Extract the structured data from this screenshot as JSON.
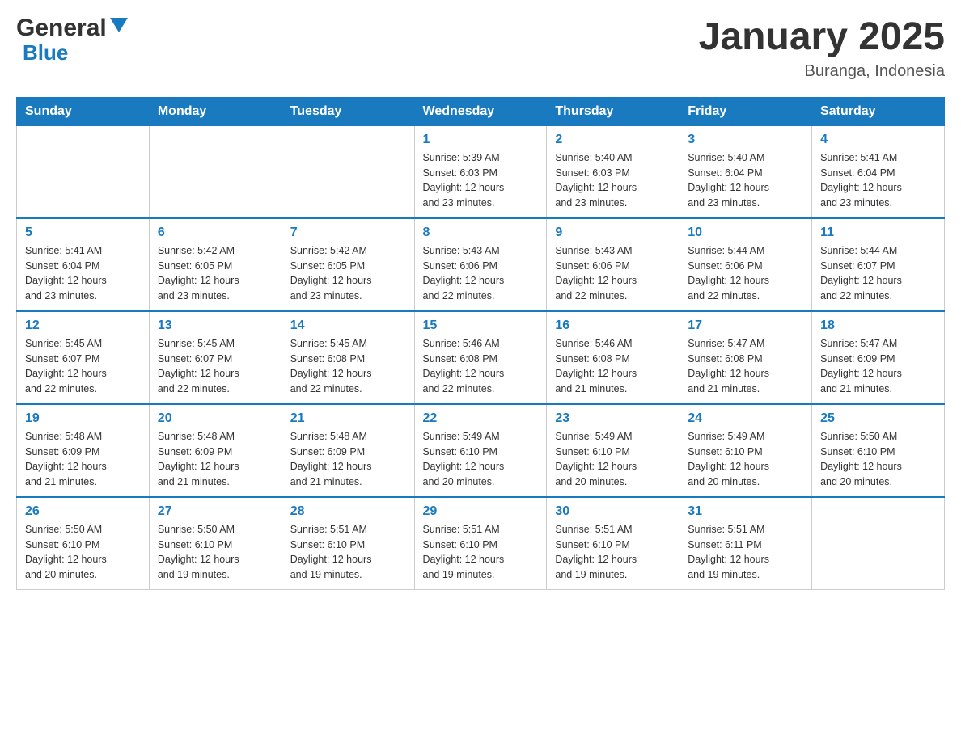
{
  "header": {
    "title": "January 2025",
    "location": "Buranga, Indonesia",
    "logo_general": "General",
    "logo_blue": "Blue"
  },
  "calendar": {
    "days_of_week": [
      "Sunday",
      "Monday",
      "Tuesday",
      "Wednesday",
      "Thursday",
      "Friday",
      "Saturday"
    ],
    "weeks": [
      [
        {
          "day": "",
          "info": ""
        },
        {
          "day": "",
          "info": ""
        },
        {
          "day": "",
          "info": ""
        },
        {
          "day": "1",
          "info": "Sunrise: 5:39 AM\nSunset: 6:03 PM\nDaylight: 12 hours\nand 23 minutes."
        },
        {
          "day": "2",
          "info": "Sunrise: 5:40 AM\nSunset: 6:03 PM\nDaylight: 12 hours\nand 23 minutes."
        },
        {
          "day": "3",
          "info": "Sunrise: 5:40 AM\nSunset: 6:04 PM\nDaylight: 12 hours\nand 23 minutes."
        },
        {
          "day": "4",
          "info": "Sunrise: 5:41 AM\nSunset: 6:04 PM\nDaylight: 12 hours\nand 23 minutes."
        }
      ],
      [
        {
          "day": "5",
          "info": "Sunrise: 5:41 AM\nSunset: 6:04 PM\nDaylight: 12 hours\nand 23 minutes."
        },
        {
          "day": "6",
          "info": "Sunrise: 5:42 AM\nSunset: 6:05 PM\nDaylight: 12 hours\nand 23 minutes."
        },
        {
          "day": "7",
          "info": "Sunrise: 5:42 AM\nSunset: 6:05 PM\nDaylight: 12 hours\nand 23 minutes."
        },
        {
          "day": "8",
          "info": "Sunrise: 5:43 AM\nSunset: 6:06 PM\nDaylight: 12 hours\nand 22 minutes."
        },
        {
          "day": "9",
          "info": "Sunrise: 5:43 AM\nSunset: 6:06 PM\nDaylight: 12 hours\nand 22 minutes."
        },
        {
          "day": "10",
          "info": "Sunrise: 5:44 AM\nSunset: 6:06 PM\nDaylight: 12 hours\nand 22 minutes."
        },
        {
          "day": "11",
          "info": "Sunrise: 5:44 AM\nSunset: 6:07 PM\nDaylight: 12 hours\nand 22 minutes."
        }
      ],
      [
        {
          "day": "12",
          "info": "Sunrise: 5:45 AM\nSunset: 6:07 PM\nDaylight: 12 hours\nand 22 minutes."
        },
        {
          "day": "13",
          "info": "Sunrise: 5:45 AM\nSunset: 6:07 PM\nDaylight: 12 hours\nand 22 minutes."
        },
        {
          "day": "14",
          "info": "Sunrise: 5:45 AM\nSunset: 6:08 PM\nDaylight: 12 hours\nand 22 minutes."
        },
        {
          "day": "15",
          "info": "Sunrise: 5:46 AM\nSunset: 6:08 PM\nDaylight: 12 hours\nand 22 minutes."
        },
        {
          "day": "16",
          "info": "Sunrise: 5:46 AM\nSunset: 6:08 PM\nDaylight: 12 hours\nand 21 minutes."
        },
        {
          "day": "17",
          "info": "Sunrise: 5:47 AM\nSunset: 6:08 PM\nDaylight: 12 hours\nand 21 minutes."
        },
        {
          "day": "18",
          "info": "Sunrise: 5:47 AM\nSunset: 6:09 PM\nDaylight: 12 hours\nand 21 minutes."
        }
      ],
      [
        {
          "day": "19",
          "info": "Sunrise: 5:48 AM\nSunset: 6:09 PM\nDaylight: 12 hours\nand 21 minutes."
        },
        {
          "day": "20",
          "info": "Sunrise: 5:48 AM\nSunset: 6:09 PM\nDaylight: 12 hours\nand 21 minutes."
        },
        {
          "day": "21",
          "info": "Sunrise: 5:48 AM\nSunset: 6:09 PM\nDaylight: 12 hours\nand 21 minutes."
        },
        {
          "day": "22",
          "info": "Sunrise: 5:49 AM\nSunset: 6:10 PM\nDaylight: 12 hours\nand 20 minutes."
        },
        {
          "day": "23",
          "info": "Sunrise: 5:49 AM\nSunset: 6:10 PM\nDaylight: 12 hours\nand 20 minutes."
        },
        {
          "day": "24",
          "info": "Sunrise: 5:49 AM\nSunset: 6:10 PM\nDaylight: 12 hours\nand 20 minutes."
        },
        {
          "day": "25",
          "info": "Sunrise: 5:50 AM\nSunset: 6:10 PM\nDaylight: 12 hours\nand 20 minutes."
        }
      ],
      [
        {
          "day": "26",
          "info": "Sunrise: 5:50 AM\nSunset: 6:10 PM\nDaylight: 12 hours\nand 20 minutes."
        },
        {
          "day": "27",
          "info": "Sunrise: 5:50 AM\nSunset: 6:10 PM\nDaylight: 12 hours\nand 19 minutes."
        },
        {
          "day": "28",
          "info": "Sunrise: 5:51 AM\nSunset: 6:10 PM\nDaylight: 12 hours\nand 19 minutes."
        },
        {
          "day": "29",
          "info": "Sunrise: 5:51 AM\nSunset: 6:10 PM\nDaylight: 12 hours\nand 19 minutes."
        },
        {
          "day": "30",
          "info": "Sunrise: 5:51 AM\nSunset: 6:10 PM\nDaylight: 12 hours\nand 19 minutes."
        },
        {
          "day": "31",
          "info": "Sunrise: 5:51 AM\nSunset: 6:11 PM\nDaylight: 12 hours\nand 19 minutes."
        },
        {
          "day": "",
          "info": ""
        }
      ]
    ]
  }
}
